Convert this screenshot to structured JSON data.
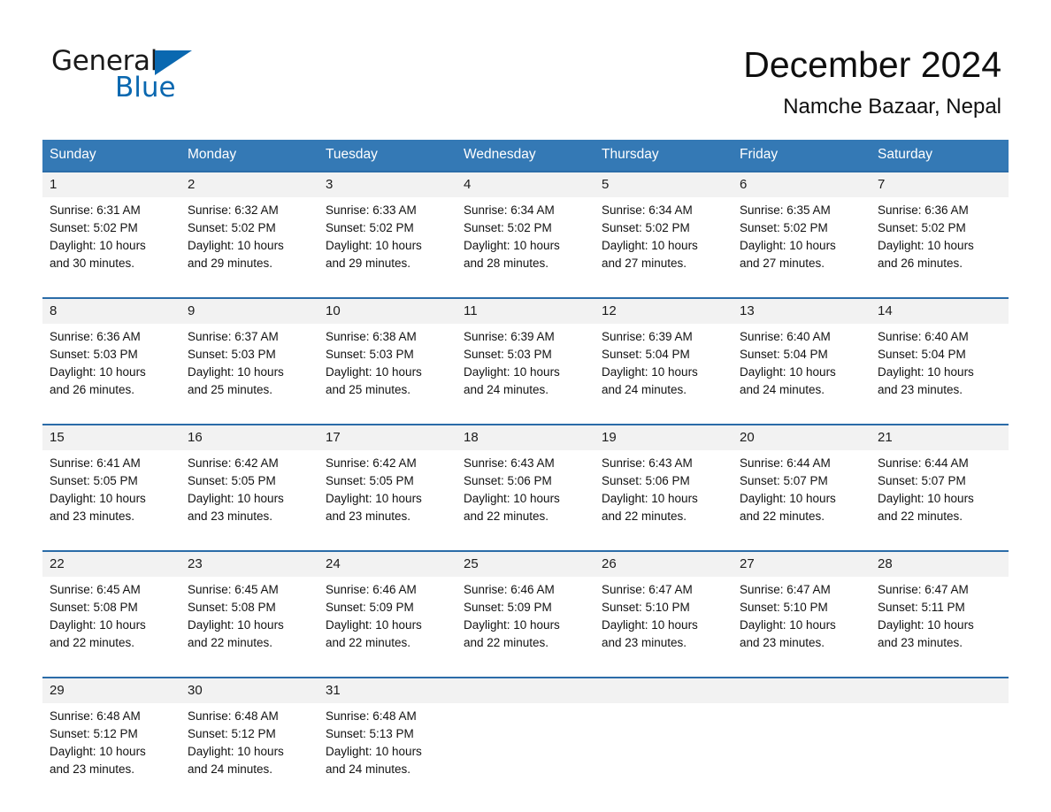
{
  "brand": {
    "name_part1": "General",
    "name_part2": "Blue",
    "accent_color": "#0a68b0",
    "triangle_icon": "triangle-icon"
  },
  "header": {
    "month_title": "December 2024",
    "location": "Namche Bazaar, Nepal"
  },
  "calendar": {
    "header_color": "#3479b5",
    "row_divider_color": "#2b6ca8",
    "daynum_band_color": "#f2f2f2",
    "weekdays": [
      "Sunday",
      "Monday",
      "Tuesday",
      "Wednesday",
      "Thursday",
      "Friday",
      "Saturday"
    ],
    "weeks": [
      [
        {
          "day": "1",
          "sunrise": "Sunrise: 6:31 AM",
          "sunset": "Sunset: 5:02 PM",
          "daylight_line1": "Daylight: 10 hours",
          "daylight_line2": "and 30 minutes."
        },
        {
          "day": "2",
          "sunrise": "Sunrise: 6:32 AM",
          "sunset": "Sunset: 5:02 PM",
          "daylight_line1": "Daylight: 10 hours",
          "daylight_line2": "and 29 minutes."
        },
        {
          "day": "3",
          "sunrise": "Sunrise: 6:33 AM",
          "sunset": "Sunset: 5:02 PM",
          "daylight_line1": "Daylight: 10 hours",
          "daylight_line2": "and 29 minutes."
        },
        {
          "day": "4",
          "sunrise": "Sunrise: 6:34 AM",
          "sunset": "Sunset: 5:02 PM",
          "daylight_line1": "Daylight: 10 hours",
          "daylight_line2": "and 28 minutes."
        },
        {
          "day": "5",
          "sunrise": "Sunrise: 6:34 AM",
          "sunset": "Sunset: 5:02 PM",
          "daylight_line1": "Daylight: 10 hours",
          "daylight_line2": "and 27 minutes."
        },
        {
          "day": "6",
          "sunrise": "Sunrise: 6:35 AM",
          "sunset": "Sunset: 5:02 PM",
          "daylight_line1": "Daylight: 10 hours",
          "daylight_line2": "and 27 minutes."
        },
        {
          "day": "7",
          "sunrise": "Sunrise: 6:36 AM",
          "sunset": "Sunset: 5:02 PM",
          "daylight_line1": "Daylight: 10 hours",
          "daylight_line2": "and 26 minutes."
        }
      ],
      [
        {
          "day": "8",
          "sunrise": "Sunrise: 6:36 AM",
          "sunset": "Sunset: 5:03 PM",
          "daylight_line1": "Daylight: 10 hours",
          "daylight_line2": "and 26 minutes."
        },
        {
          "day": "9",
          "sunrise": "Sunrise: 6:37 AM",
          "sunset": "Sunset: 5:03 PM",
          "daylight_line1": "Daylight: 10 hours",
          "daylight_line2": "and 25 minutes."
        },
        {
          "day": "10",
          "sunrise": "Sunrise: 6:38 AM",
          "sunset": "Sunset: 5:03 PM",
          "daylight_line1": "Daylight: 10 hours",
          "daylight_line2": "and 25 minutes."
        },
        {
          "day": "11",
          "sunrise": "Sunrise: 6:39 AM",
          "sunset": "Sunset: 5:03 PM",
          "daylight_line1": "Daylight: 10 hours",
          "daylight_line2": "and 24 minutes."
        },
        {
          "day": "12",
          "sunrise": "Sunrise: 6:39 AM",
          "sunset": "Sunset: 5:04 PM",
          "daylight_line1": "Daylight: 10 hours",
          "daylight_line2": "and 24 minutes."
        },
        {
          "day": "13",
          "sunrise": "Sunrise: 6:40 AM",
          "sunset": "Sunset: 5:04 PM",
          "daylight_line1": "Daylight: 10 hours",
          "daylight_line2": "and 24 minutes."
        },
        {
          "day": "14",
          "sunrise": "Sunrise: 6:40 AM",
          "sunset": "Sunset: 5:04 PM",
          "daylight_line1": "Daylight: 10 hours",
          "daylight_line2": "and 23 minutes."
        }
      ],
      [
        {
          "day": "15",
          "sunrise": "Sunrise: 6:41 AM",
          "sunset": "Sunset: 5:05 PM",
          "daylight_line1": "Daylight: 10 hours",
          "daylight_line2": "and 23 minutes."
        },
        {
          "day": "16",
          "sunrise": "Sunrise: 6:42 AM",
          "sunset": "Sunset: 5:05 PM",
          "daylight_line1": "Daylight: 10 hours",
          "daylight_line2": "and 23 minutes."
        },
        {
          "day": "17",
          "sunrise": "Sunrise: 6:42 AM",
          "sunset": "Sunset: 5:05 PM",
          "daylight_line1": "Daylight: 10 hours",
          "daylight_line2": "and 23 minutes."
        },
        {
          "day": "18",
          "sunrise": "Sunrise: 6:43 AM",
          "sunset": "Sunset: 5:06 PM",
          "daylight_line1": "Daylight: 10 hours",
          "daylight_line2": "and 22 minutes."
        },
        {
          "day": "19",
          "sunrise": "Sunrise: 6:43 AM",
          "sunset": "Sunset: 5:06 PM",
          "daylight_line1": "Daylight: 10 hours",
          "daylight_line2": "and 22 minutes."
        },
        {
          "day": "20",
          "sunrise": "Sunrise: 6:44 AM",
          "sunset": "Sunset: 5:07 PM",
          "daylight_line1": "Daylight: 10 hours",
          "daylight_line2": "and 22 minutes."
        },
        {
          "day": "21",
          "sunrise": "Sunrise: 6:44 AM",
          "sunset": "Sunset: 5:07 PM",
          "daylight_line1": "Daylight: 10 hours",
          "daylight_line2": "and 22 minutes."
        }
      ],
      [
        {
          "day": "22",
          "sunrise": "Sunrise: 6:45 AM",
          "sunset": "Sunset: 5:08 PM",
          "daylight_line1": "Daylight: 10 hours",
          "daylight_line2": "and 22 minutes."
        },
        {
          "day": "23",
          "sunrise": "Sunrise: 6:45 AM",
          "sunset": "Sunset: 5:08 PM",
          "daylight_line1": "Daylight: 10 hours",
          "daylight_line2": "and 22 minutes."
        },
        {
          "day": "24",
          "sunrise": "Sunrise: 6:46 AM",
          "sunset": "Sunset: 5:09 PM",
          "daylight_line1": "Daylight: 10 hours",
          "daylight_line2": "and 22 minutes."
        },
        {
          "day": "25",
          "sunrise": "Sunrise: 6:46 AM",
          "sunset": "Sunset: 5:09 PM",
          "daylight_line1": "Daylight: 10 hours",
          "daylight_line2": "and 22 minutes."
        },
        {
          "day": "26",
          "sunrise": "Sunrise: 6:47 AM",
          "sunset": "Sunset: 5:10 PM",
          "daylight_line1": "Daylight: 10 hours",
          "daylight_line2": "and 23 minutes."
        },
        {
          "day": "27",
          "sunrise": "Sunrise: 6:47 AM",
          "sunset": "Sunset: 5:10 PM",
          "daylight_line1": "Daylight: 10 hours",
          "daylight_line2": "and 23 minutes."
        },
        {
          "day": "28",
          "sunrise": "Sunrise: 6:47 AM",
          "sunset": "Sunset: 5:11 PM",
          "daylight_line1": "Daylight: 10 hours",
          "daylight_line2": "and 23 minutes."
        }
      ],
      [
        {
          "day": "29",
          "sunrise": "Sunrise: 6:48 AM",
          "sunset": "Sunset: 5:12 PM",
          "daylight_line1": "Daylight: 10 hours",
          "daylight_line2": "and 23 minutes."
        },
        {
          "day": "30",
          "sunrise": "Sunrise: 6:48 AM",
          "sunset": "Sunset: 5:12 PM",
          "daylight_line1": "Daylight: 10 hours",
          "daylight_line2": "and 24 minutes."
        },
        {
          "day": "31",
          "sunrise": "Sunrise: 6:48 AM",
          "sunset": "Sunset: 5:13 PM",
          "daylight_line1": "Daylight: 10 hours",
          "daylight_line2": "and 24 minutes."
        },
        {
          "day": "",
          "sunrise": "",
          "sunset": "",
          "daylight_line1": "",
          "daylight_line2": ""
        },
        {
          "day": "",
          "sunrise": "",
          "sunset": "",
          "daylight_line1": "",
          "daylight_line2": ""
        },
        {
          "day": "",
          "sunrise": "",
          "sunset": "",
          "daylight_line1": "",
          "daylight_line2": ""
        },
        {
          "day": "",
          "sunrise": "",
          "sunset": "",
          "daylight_line1": "",
          "daylight_line2": ""
        }
      ]
    ]
  }
}
